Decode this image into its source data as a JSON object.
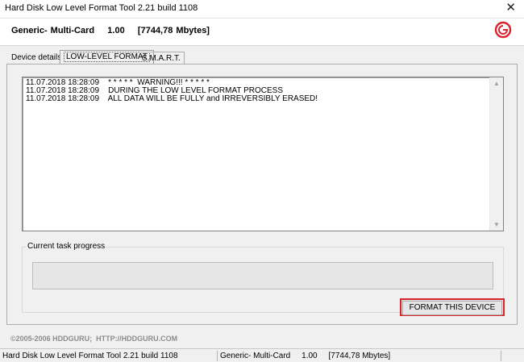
{
  "window": {
    "title": "Hard Disk Low Level Format Tool 2.21 build 1108",
    "close_glyph": "✕"
  },
  "header": {
    "device_info": "Generic- Multi-Card    1.00    [7744,78 Mbytes]"
  },
  "tabs": [
    {
      "label": "Device details"
    },
    {
      "label": "LOW-LEVEL FORMAT",
      "active": true
    },
    {
      "label": "S.M.A.R.T."
    }
  ],
  "log": {
    "lines": [
      "11.07.2018 18:28:09    * * * * *  WARNING!!! * * * * *",
      "11.07.2018 18:28:09    DURING THE LOW LEVEL FORMAT PROCESS",
      "11.07.2018 18:28:09    ALL DATA WILL BE FULLY and IRREVERSIBLY ERASED!"
    ]
  },
  "progress_group": {
    "legend": "Current task progress",
    "value_percent": 0
  },
  "format_button": {
    "label": "FORMAT THIS DEVICE",
    "highlight_color": "#d9232d"
  },
  "footer": {
    "copyright": "©2005-2006 HDDGURU;  HTTP://HDDGURU.COM"
  },
  "statusbar": {
    "app": "Hard Disk Low Level Format Tool 2.21 build 1108",
    "device": "Generic- Multi-Card     1.00     [7744,78 Mbytes]"
  },
  "icons": {
    "logo": "hddguru-logo-icon",
    "scroll_up": "▲",
    "scroll_down": "▼"
  }
}
